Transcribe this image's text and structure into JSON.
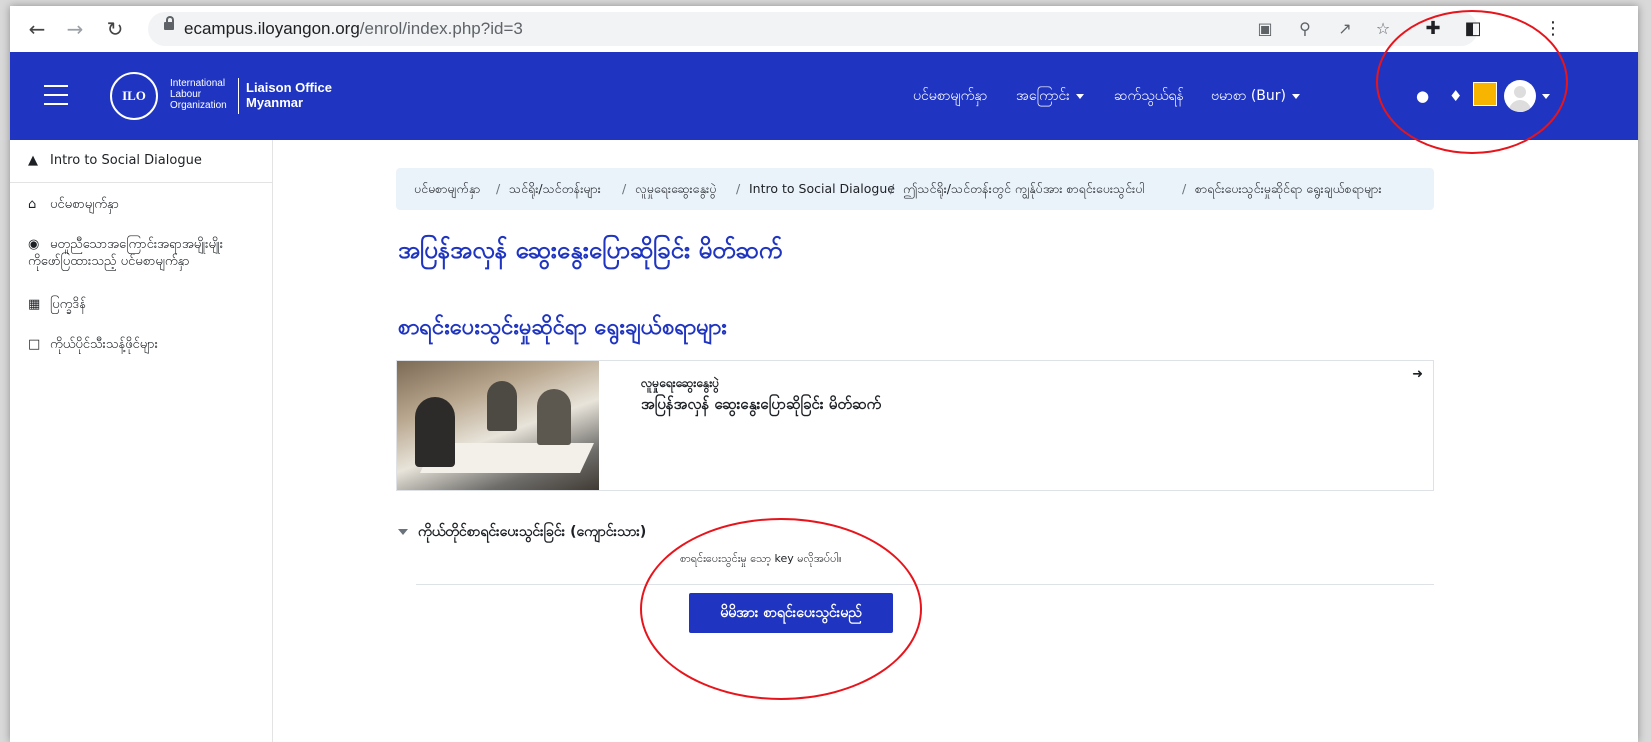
{
  "browser": {
    "url_domain": "ecampus.iloyangon.org",
    "url_path": "/enrol/index.php?id=3"
  },
  "navbar": {
    "logo_emblem": "ILO",
    "logo_org": "International\nLabour\nOrganization",
    "logo_office": "Liaison Office\nMyanmar",
    "links": [
      "ပင်မစာမျက်နှာ",
      "အကြောင်း",
      "ဆက်သွယ်ရန်",
      "ဗမာစာ (Bur)"
    ],
    "accent_color": "#1f35c1"
  },
  "sidebar": {
    "course_title": "Intro to Social Dialogue",
    "items": [
      {
        "label": "ပင်မစာမျက်နှာ",
        "icon": "home-icon"
      },
      {
        "label": "မတူညီသောအကြောင်းအရာအမျိုးမျိုး\nကိုဖော်ပြထားသည့် ပင်မစာမျက်နှာ",
        "icon": "dashboard-icon"
      },
      {
        "label": "ပြက္ခဒိန်",
        "icon": "calendar-icon"
      },
      {
        "label": "ကိုယ်ပိုင်သီးသန့်ဖိုင်များ",
        "icon": "file-icon"
      }
    ]
  },
  "breadcrumb": [
    "ပင်မစာမျက်နှာ",
    "သင်ရိုး/သင်တန်းများ",
    "လူမှုရေးဆွေးနွေးပွဲ",
    "Intro to Social Dialogue",
    "ဤသင်ရိုး/သင်တန်းတွင် ကျွန်ုပ်အား စာရင်းပေးသွင်းပါ",
    "စာရင်းပေးသွင်းမှုဆိုင်ရာ ရွေးချယ်စရာများ"
  ],
  "main": {
    "page_title": "အပြန်အလှန် ဆွေးနွေးပြောဆိုခြင်း မိတ်ဆက်",
    "section_title": "စာရင်းပေးသွင်းမှုဆိုင်ရာ ရွေးချယ်စရာများ",
    "course_card": {
      "category": "လူမှုရေးဆွေးနွေးပွဲ",
      "name": "အပြန်အလှန် ဆွေးနွေးပြောဆိုခြင်း မိတ်ဆက်"
    },
    "self_enrol_header": "ကိုယ်တိုင်စာရင်းပေးသွင်းခြင်း (ကျောင်းသား)",
    "no_key_text": "စာရင်းပေးသွင်းမှု သော့ key မလိုအပ်ပါ။",
    "enrol_button": "မိမိအား စာရင်းပေးသွင်းမည်"
  }
}
